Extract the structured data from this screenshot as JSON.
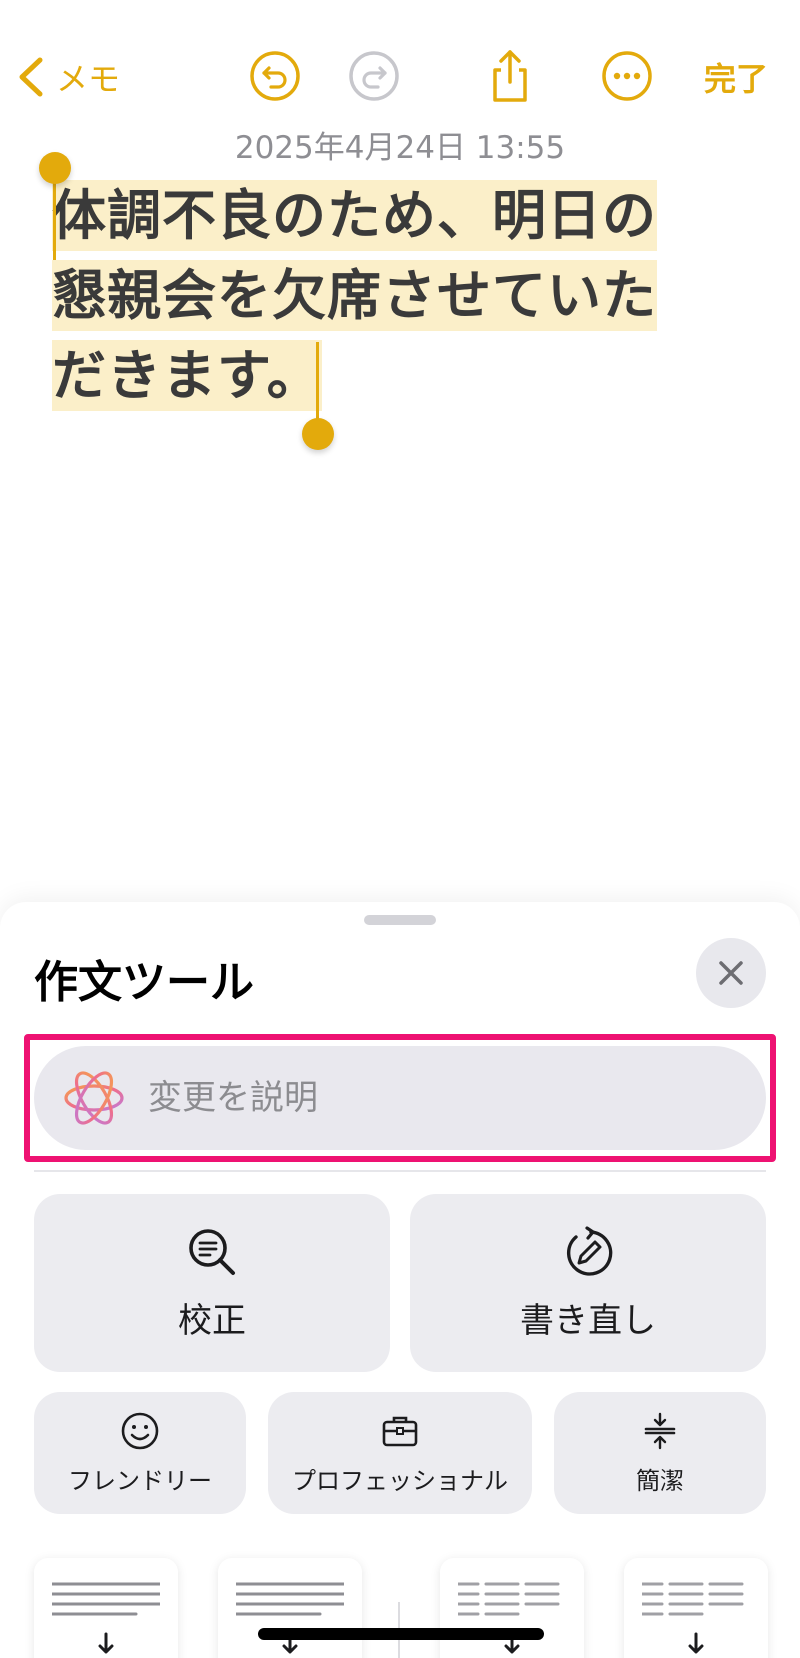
{
  "toolbar": {
    "back_label": "メモ",
    "done_label": "完了"
  },
  "note": {
    "timestamp": "2025年4月24日 13:55",
    "lines": [
      "体調不良のため、明日の",
      "懇親会を欠席させていた",
      "だきます。"
    ]
  },
  "writing_tools": {
    "title": "作文ツール",
    "describe_placeholder": "変更を説明",
    "primary_tools": [
      {
        "label": "校正",
        "icon": "proofread-magnifier-icon"
      },
      {
        "label": "書き直し",
        "icon": "rewrite-pen-icon"
      }
    ],
    "tone_tools": [
      {
        "label": "フレンドリー",
        "icon": "smiley-icon"
      },
      {
        "label": "プロフェッショナル",
        "icon": "briefcase-icon"
      },
      {
        "label": "簡潔",
        "icon": "concise-icon"
      }
    ]
  },
  "colors": {
    "accent": "#e3aa0c",
    "highlight": "#fbefc9",
    "focus_frame": "#ee1272"
  }
}
